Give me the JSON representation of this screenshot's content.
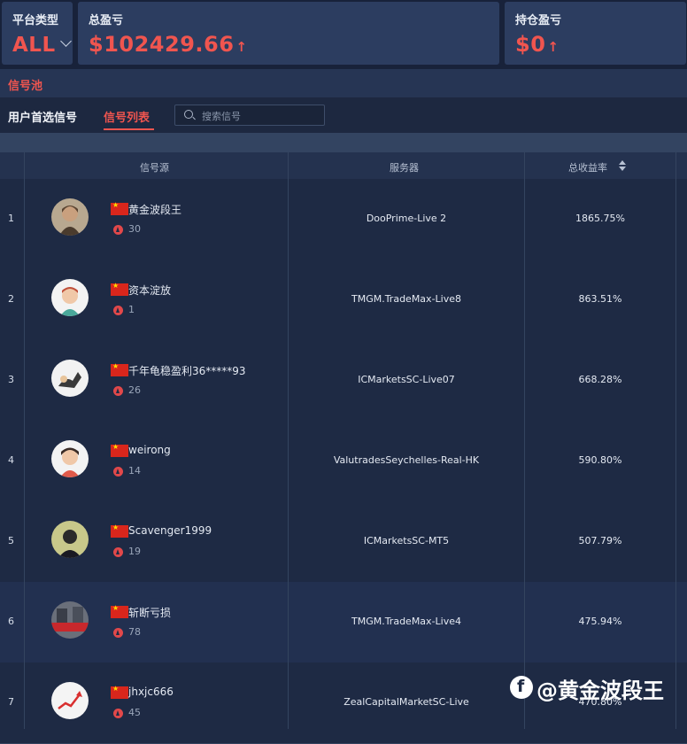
{
  "header": {
    "platform": {
      "label": "平台类型",
      "value": "ALL"
    },
    "total_pnl": {
      "label": "总盈亏",
      "value": "$102429.66"
    },
    "position_pnl": {
      "label": "持仓盈亏",
      "value": "$0"
    }
  },
  "pool_title": "信号池",
  "tabs": [
    {
      "label": "用户首选信号"
    },
    {
      "label": "信号列表"
    }
  ],
  "search": {
    "placeholder": "搜索信号"
  },
  "table": {
    "columns": [
      "信号源",
      "服务器",
      "总收益率"
    ],
    "rows": [
      {
        "index": "1",
        "name": "黄金波段王",
        "count": "30",
        "server": "DooPrime-Live 2",
        "return": "1865.75%"
      },
      {
        "index": "2",
        "name": "资本淀放",
        "count": "1",
        "server": "TMGM.TradeMax-Live8",
        "return": "863.51%"
      },
      {
        "index": "3",
        "name": "千年龟稳盈利36*****93",
        "count": "26",
        "server": "ICMarketsSC-Live07",
        "return": "668.28%"
      },
      {
        "index": "4",
        "name": "weirong",
        "count": "14",
        "server": "ValutradesSeychelles-Real-HK",
        "return": "590.80%"
      },
      {
        "index": "5",
        "name": "Scavenger1999",
        "count": "19",
        "server": "ICMarketsSC-MT5",
        "return": "507.79%"
      },
      {
        "index": "6",
        "name": "斩断亏损",
        "count": "78",
        "server": "TMGM.TradeMax-Live4",
        "return": "475.94%"
      },
      {
        "index": "7",
        "name": "jhxjc666",
        "count": "45",
        "server": "ZealCapitalMarketSC-Live",
        "return": "470.80%"
      }
    ]
  },
  "watermark": "@黄金波段王",
  "colors": {
    "accent": "#f0554f",
    "background": "#1e2a44",
    "header_card": "#2c3d60"
  }
}
